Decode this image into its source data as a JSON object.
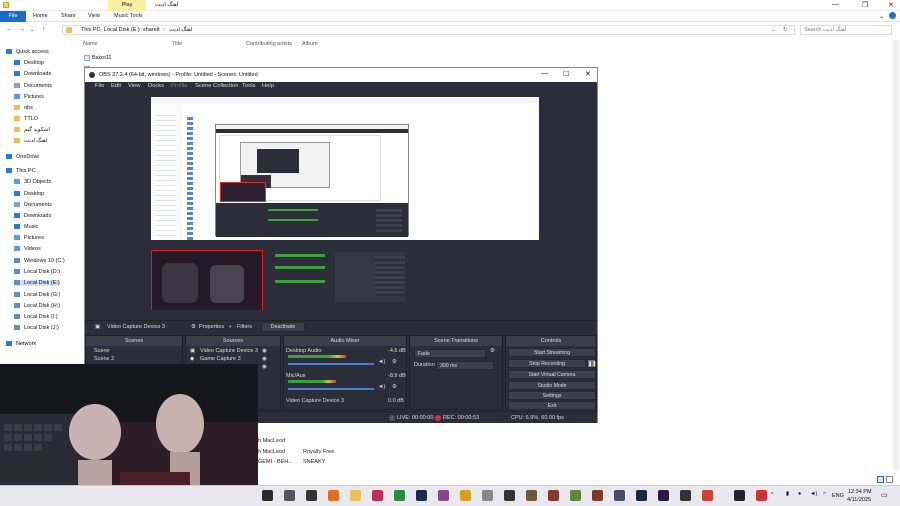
{
  "explorer": {
    "title": "اهنگ ادیت",
    "play_tab": "Play",
    "ribbon": {
      "file": "File",
      "home": "Home",
      "share": "Share",
      "view": "View",
      "music_tools": "Music Tools"
    },
    "address": {
      "this_pc": "This PC",
      "disk": "Local Disk (E:)",
      "folder1": "shareit",
      "folder2": "اهنگ ادیت"
    },
    "search_placeholder": "Search اهنگ ادیت",
    "columns": {
      "name": "Name",
      "title": "Title",
      "artists": "Contributing artists",
      "album": "Album"
    },
    "sidebar": [
      {
        "label": "Quick access",
        "icon": "star-icon",
        "color": "#2a7bd6"
      },
      {
        "label": "Desktop",
        "icon": "desktop-icon",
        "color": "#2a7bd6"
      },
      {
        "label": "Downloads",
        "icon": "download-icon",
        "color": "#2a7bd6"
      },
      {
        "label": "Documents",
        "icon": "document-icon",
        "color": "#8aa0b8"
      },
      {
        "label": "Pictures",
        "icon": "picture-icon",
        "color": "#5a9bd6"
      },
      {
        "label": "obs",
        "icon": "folder-icon",
        "color": "#e8c15a"
      },
      {
        "label": "TTLO",
        "icon": "folder-icon",
        "color": "#e8c15a"
      },
      {
        "label": "اسکوید گیم",
        "icon": "folder-icon",
        "color": "#e8c15a"
      },
      {
        "label": "اهنگ ادیت",
        "icon": "folder-icon",
        "color": "#e8c15a"
      },
      {
        "label": "OneDrive",
        "icon": "cloud-icon",
        "color": "#2a7bd6"
      },
      {
        "label": "This PC",
        "icon": "pc-icon",
        "color": "#2a7bd6"
      },
      {
        "label": "3D Objects",
        "icon": "cube-icon",
        "color": "#5a9bd6"
      },
      {
        "label": "Desktop",
        "icon": "desktop-icon",
        "color": "#2a7bd6"
      },
      {
        "label": "Documents",
        "icon": "document-icon",
        "color": "#8aa0b8"
      },
      {
        "label": "Downloads",
        "icon": "download-icon",
        "color": "#2a7bd6"
      },
      {
        "label": "Music",
        "icon": "music-icon",
        "color": "#2a7bd6"
      },
      {
        "label": "Pictures",
        "icon": "picture-icon",
        "color": "#5a9bd6"
      },
      {
        "label": "Videos",
        "icon": "video-icon",
        "color": "#5a9bd6"
      },
      {
        "label": "Windows 10 (C:)",
        "icon": "drive-icon",
        "color": "#6a8ab0"
      },
      {
        "label": "Local Disk (D:)",
        "icon": "drive-icon",
        "color": "#6a8ab0"
      },
      {
        "label": "Local Disk (E:)",
        "icon": "drive-icon",
        "color": "#6a8ab0"
      },
      {
        "label": "Local Disk (G:)",
        "icon": "drive-icon",
        "color": "#6a8ab0"
      },
      {
        "label": "Local Disk (H:)",
        "icon": "drive-icon",
        "color": "#6a8ab0"
      },
      {
        "label": "Local Disk (I:)",
        "icon": "drive-icon",
        "color": "#6a8ab0"
      },
      {
        "label": "Local Disk (J:)",
        "icon": "drive-icon",
        "color": "#6a8ab0"
      },
      {
        "label": "Network",
        "icon": "network-icon",
        "color": "#2a7bd6"
      }
    ],
    "file_first": "Baixo11",
    "lower_rows": [
      {
        "artist": "h MacLeod",
        "album": ""
      },
      {
        "artist": "h MacLeod",
        "album": "Royalty Free"
      },
      {
        "artist": "GEMI - BEH...",
        "album": "SNEAKY"
      }
    ]
  },
  "obs": {
    "title": "OBS 27.2.4 (64-bit, windows) - Profile: Untitled - Scenes: Untitled",
    "menu": [
      "File",
      "Edit",
      "View",
      "Docks",
      "Profile",
      "Scene Collection",
      "Tools",
      "Help"
    ],
    "source_bar": {
      "source": "Video Capture Device 3",
      "properties": "Properties",
      "filters": "Filters",
      "deactivate": "Deactivate"
    },
    "docks": {
      "scenes": "Scenes",
      "sources": "Sources",
      "mixer": "Audio Mixer",
      "transitions": "Scene Transitions",
      "controls": "Controls"
    },
    "scenes": [
      "Scene",
      "Scene 2"
    ],
    "sources": [
      "Video Capture Device 3",
      "Game Capture 3"
    ],
    "mixer": [
      {
        "name": "Desktop Audio",
        "db": "-4.6 dB",
        "level": 0.72
      },
      {
        "name": "Mic/Aux",
        "db": "-8.9 dB",
        "level": 0.6
      },
      {
        "name": "Video Capture Device 3",
        "db": "0.0 dB",
        "level": 0.0
      }
    ],
    "transition": {
      "type": "Fade",
      "duration_label": "Duration",
      "duration": "300 ms"
    },
    "controls": [
      "Start Streaming",
      "Stop Recording",
      "Start Virtual Camera",
      "Studio Mode",
      "Settings",
      "Exit"
    ],
    "status": {
      "live": "LIVE: 00:00:00",
      "rec": "REC: 00:00:53",
      "cpu": "CPU: 6.9%, 60.00 fps"
    }
  },
  "taskbar": {
    "lang": "ENG",
    "time": "12:34 PM",
    "date": "4/11/2025"
  }
}
